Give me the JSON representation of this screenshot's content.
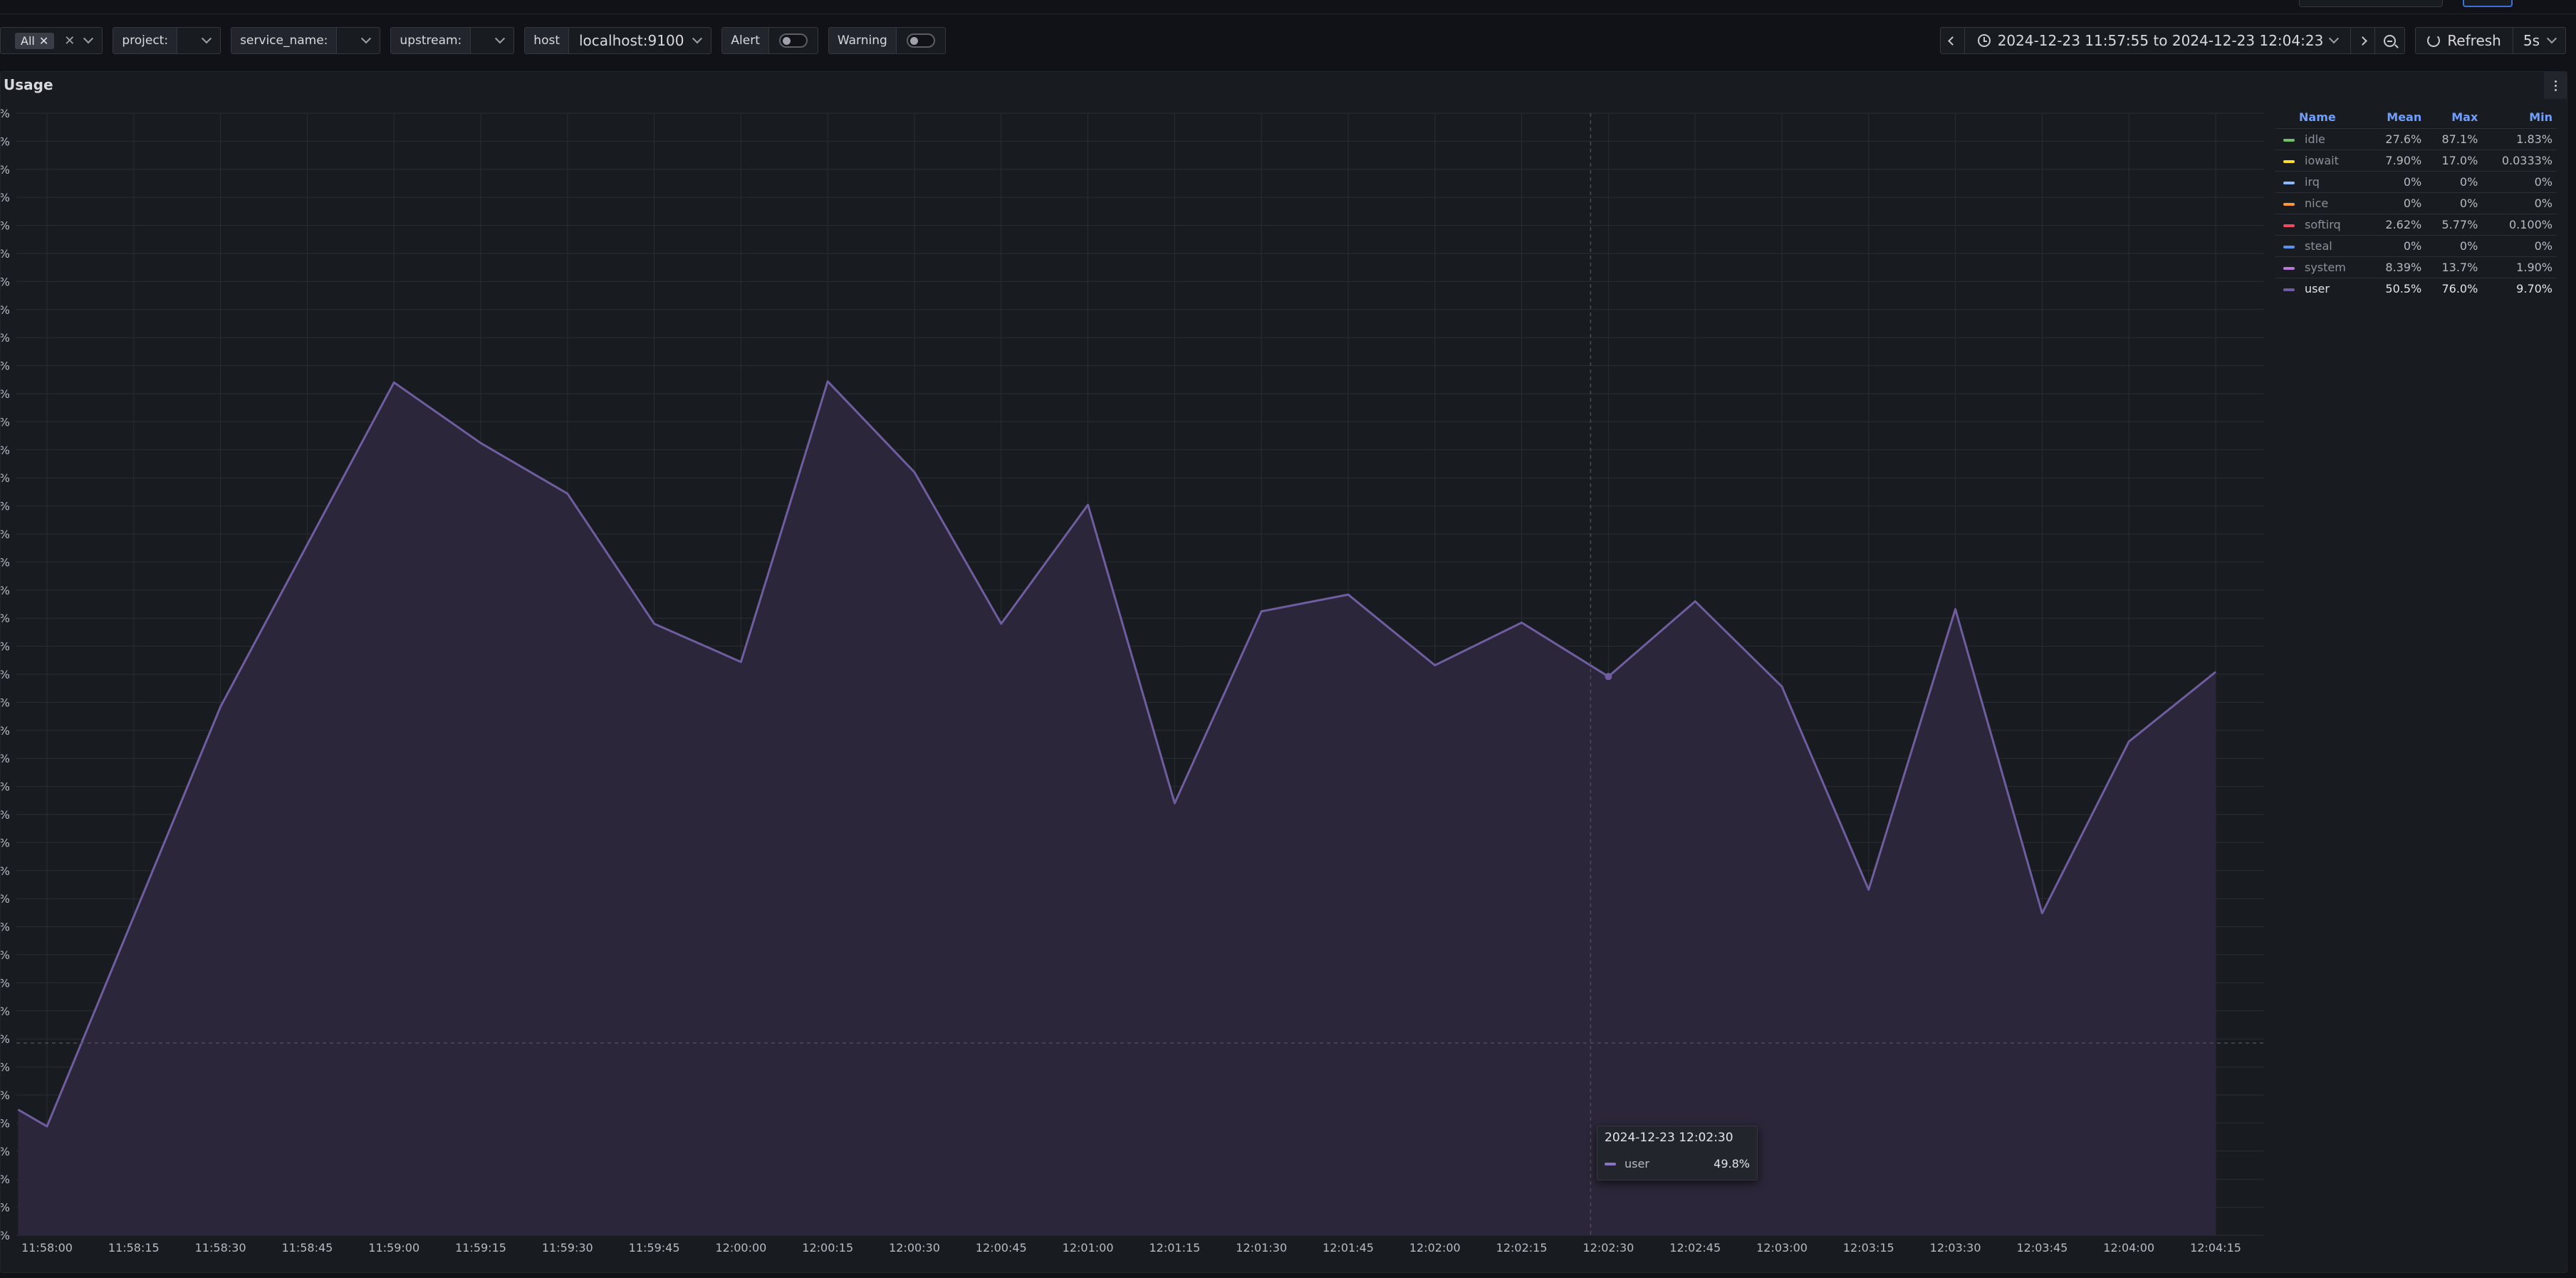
{
  "top": {
    "breadcrumb": ""
  },
  "variables": {
    "first_chip": "All",
    "project_label": "project:",
    "project_value": "",
    "service_label": "service_name:",
    "service_value": "",
    "upstream_label": "upstream:",
    "upstream_value": "",
    "host_label": "host",
    "host_value": "localhost:9100",
    "alert_label": "Alert",
    "warning_label": "Warning"
  },
  "time_controls": {
    "range": "2024-12-23 11:57:55 to 2024-12-23 12:04:23",
    "refresh_label": "Refresh",
    "interval": "5s"
  },
  "panel": {
    "title": "Usage",
    "legend": {
      "headers": [
        "Name",
        "Mean",
        "Max",
        "Min"
      ],
      "rows": [
        {
          "name": "idle",
          "mean": "27.6%",
          "max": "87.1%",
          "min": "1.83%",
          "color": "#73bf69"
        },
        {
          "name": "iowait",
          "mean": "7.90%",
          "max": "17.0%",
          "min": "0.0333%",
          "color": "#fade2a"
        },
        {
          "name": "irq",
          "mean": "0%",
          "max": "0%",
          "min": "0%",
          "color": "#8ab8ff"
        },
        {
          "name": "nice",
          "mean": "0%",
          "max": "0%",
          "min": "0%",
          "color": "#ff9830"
        },
        {
          "name": "softirq",
          "mean": "2.62%",
          "max": "5.77%",
          "min": "0.100%",
          "color": "#f2495c"
        },
        {
          "name": "steal",
          "mean": "0%",
          "max": "0%",
          "min": "0%",
          "color": "#5794f2"
        },
        {
          "name": "system",
          "mean": "8.39%",
          "max": "13.7%",
          "min": "1.90%",
          "color": "#b877d9"
        },
        {
          "name": "user",
          "mean": "50.5%",
          "max": "76.0%",
          "min": "9.70%",
          "color": "#705da0"
        }
      ]
    },
    "tooltip": {
      "time": "2024-12-23 12:02:30",
      "series": "user",
      "value": "49.8%"
    }
  },
  "chart_data": {
    "type": "area",
    "series": [
      {
        "name": "user",
        "x": [
          "11:57:55",
          "11:58:00",
          "11:58:30",
          "11:59:00",
          "11:59:15",
          "11:59:30",
          "11:59:45",
          "12:00:00",
          "12:00:15",
          "12:00:30",
          "12:00:45",
          "12:01:00",
          "12:01:15",
          "12:01:30",
          "12:01:45",
          "12:02:00",
          "12:02:15",
          "12:02:30",
          "12:02:45",
          "12:03:00",
          "12:03:15",
          "12:03:30",
          "12:03:45",
          "12:04:00",
          "12:04:15"
        ],
        "values": [
          11.2,
          9.7,
          47.1,
          76.0,
          70.6,
          66.1,
          54.5,
          51.1,
          76.1,
          68.0,
          54.5,
          65.1,
          38.5,
          55.6,
          57.1,
          50.8,
          54.6,
          49.8,
          56.5,
          48.9,
          30.8,
          55.8,
          28.7,
          44.0,
          50.2
        ]
      }
    ],
    "xticks": [
      "11:58:00",
      "11:58:15",
      "11:58:30",
      "11:58:45",
      "11:59:00",
      "11:59:15",
      "11:59:30",
      "11:59:45",
      "12:00:00",
      "12:00:15",
      "12:00:30",
      "12:00:45",
      "12:01:00",
      "12:01:15",
      "12:01:30",
      "12:01:45",
      "12:02:00",
      "12:02:15",
      "12:02:30",
      "12:02:45",
      "12:03:00",
      "12:03:15",
      "12:03:30",
      "12:03:45",
      "12:04:00",
      "12:04:15"
    ],
    "ylim": [
      0,
      100
    ],
    "grid": true,
    "legend": "right",
    "colors": {
      "line": "#705da0",
      "fill": "#2b2639",
      "grid": "#2a2d33",
      "background": "#181b1f"
    }
  }
}
